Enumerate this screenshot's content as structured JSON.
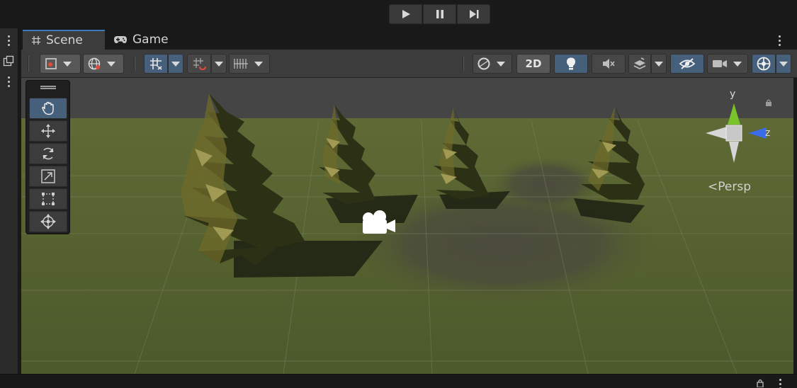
{
  "playbar": {
    "play": "play-icon",
    "pause": "pause-icon",
    "step": "step-icon"
  },
  "tabs": [
    {
      "label": "Scene",
      "icon": "hash-icon",
      "active": true
    },
    {
      "label": "Game",
      "icon": "gamepad-icon",
      "active": false
    }
  ],
  "toolbar": {
    "button_2d": "2D",
    "accent": "#46607c"
  },
  "tools": [
    "hand-icon",
    "move-icon",
    "rotate-icon",
    "scale-icon",
    "rect-icon",
    "transform-icon"
  ],
  "gizmo": {
    "y_label": "y",
    "z_label": "z",
    "projection": "Persp"
  },
  "colors": {
    "ground": "#56612f",
    "sky": "#454545",
    "gizmo_y": "#7ac22b",
    "gizmo_z": "#3a6de6"
  }
}
